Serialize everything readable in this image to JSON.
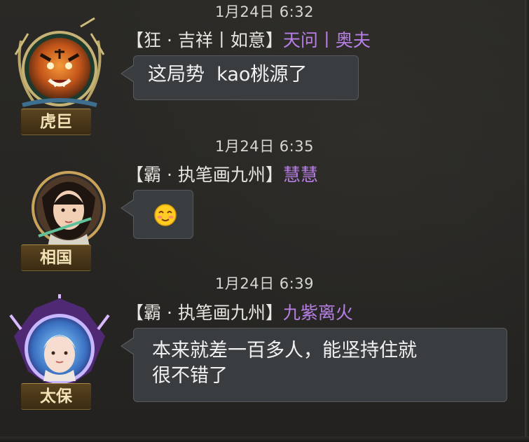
{
  "messages": [
    {
      "timestamp": "1月24日 6:32",
      "rank": "虎巨",
      "sender_tag": "【狂 · 吉祥丨如意】",
      "sender_name": "天问丨奥夫",
      "text": "这局势  kao桃源了"
    },
    {
      "timestamp": "1月24日 6:35",
      "rank": "相国",
      "sender_tag": "【霸 · 执笔画九州】",
      "sender_name": "慧慧",
      "emoji": "blush-smile-emoji"
    },
    {
      "timestamp": "1月24日 6:39",
      "rank": "太保",
      "sender_tag": "【霸 · 执笔画九州】",
      "sender_name": "九紫离火",
      "text_line1": "本来就差一百多人，能坚持住就",
      "text_line2": "很不错了"
    }
  ],
  "colors": {
    "background": "#262522",
    "bubble": "#3a3d40",
    "name_purple": "#b77fe6",
    "rank_gold": "#f3e2b6"
  }
}
